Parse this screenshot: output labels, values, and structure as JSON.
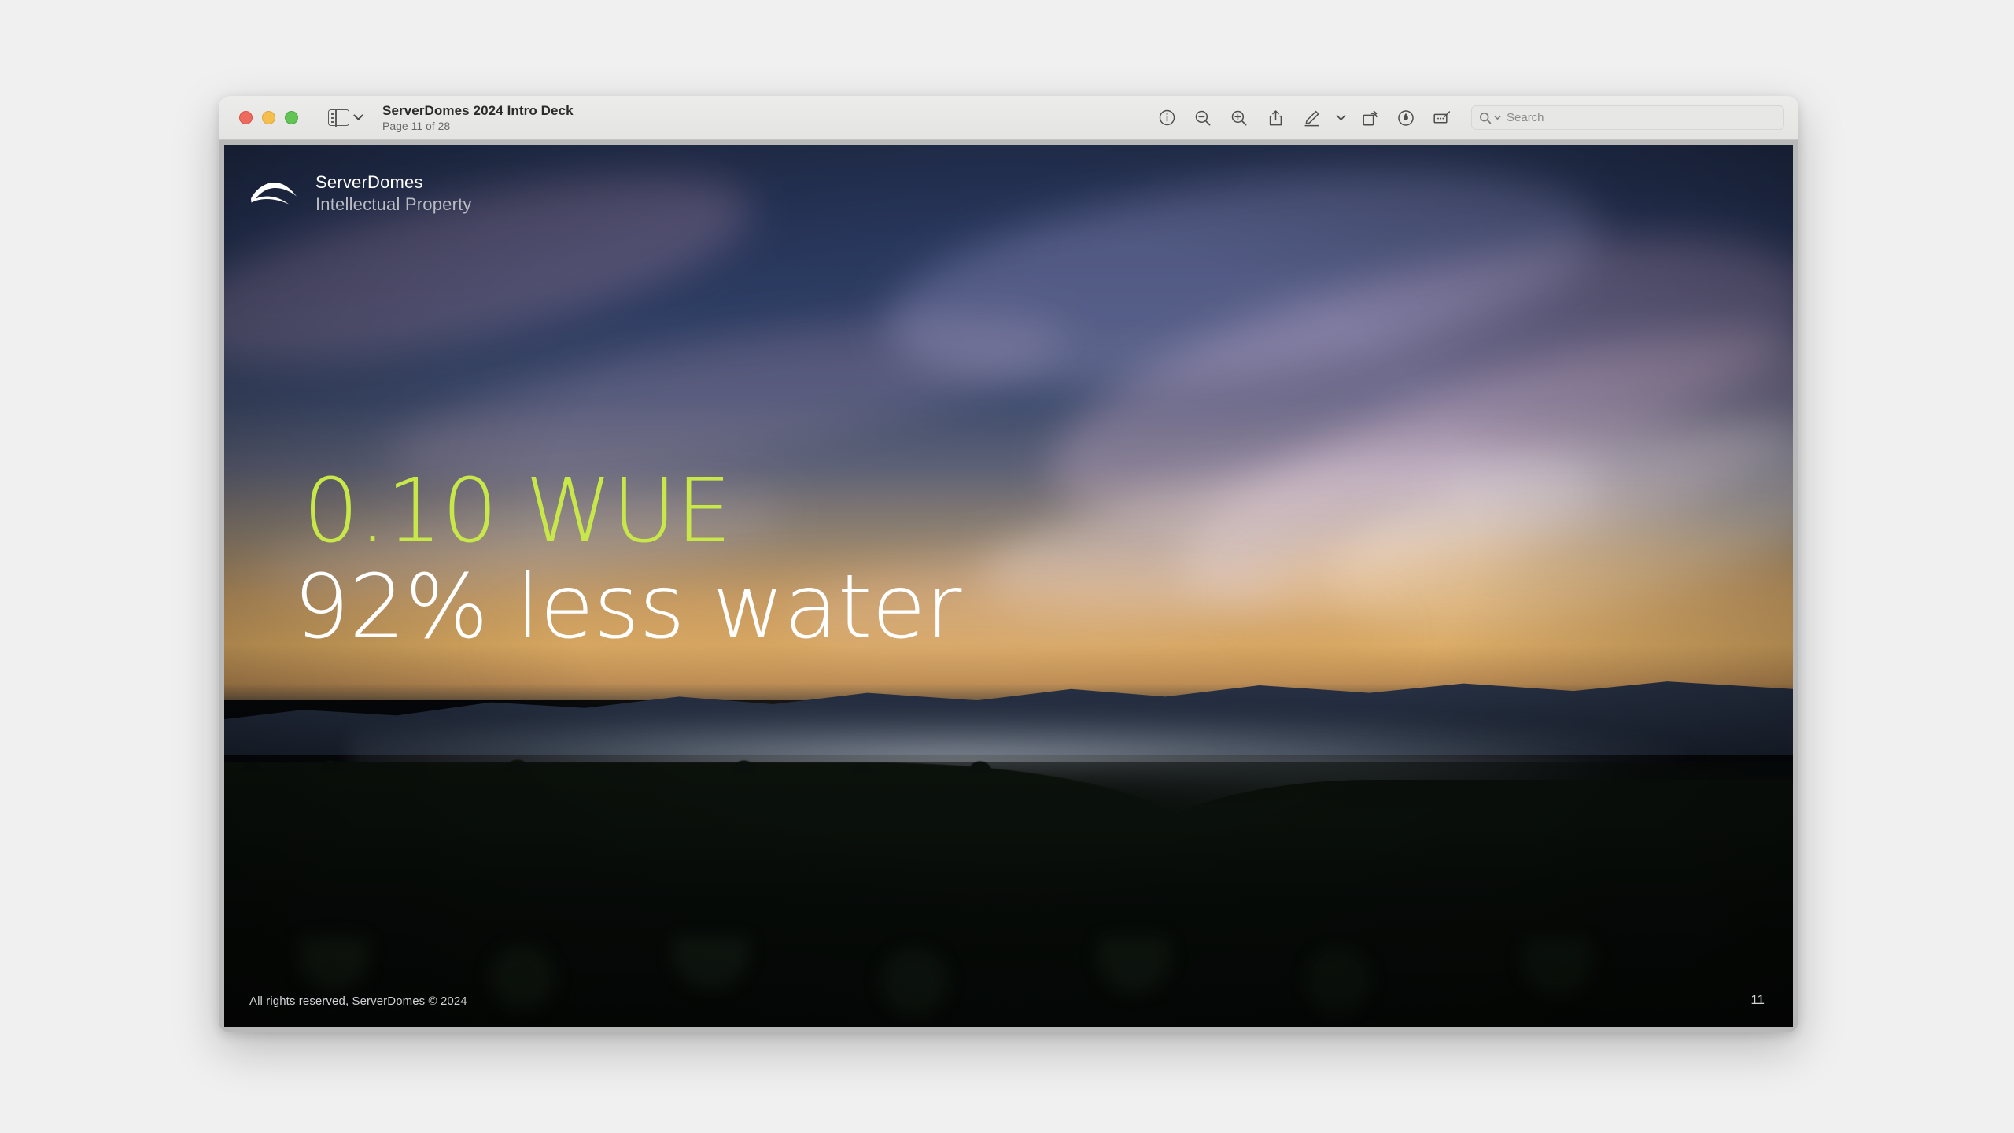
{
  "window": {
    "traffic_lights": [
      "close",
      "minimize",
      "zoom"
    ],
    "sidebar_toggle_icon": "sidebar-icon",
    "sidebar_chevron_icon": "chevron-down-icon",
    "document_title": "ServerDomes 2024 Intro Deck",
    "page_indicator": "Page 11 of 28"
  },
  "toolbar": {
    "buttons": [
      {
        "name": "info-icon",
        "label": "Info"
      },
      {
        "name": "zoom-out-icon",
        "label": "Zoom Out"
      },
      {
        "name": "zoom-in-icon",
        "label": "Zoom In"
      },
      {
        "name": "share-icon",
        "label": "Share"
      },
      {
        "name": "markup-pen-icon",
        "label": "Markup"
      },
      {
        "name": "markup-chevron-icon",
        "label": "Markup Options"
      },
      {
        "name": "rotate-right-icon",
        "label": "Rotate Right"
      },
      {
        "name": "highlight-icon",
        "label": "Highlight"
      },
      {
        "name": "annotate-icon",
        "label": "Annotate"
      }
    ],
    "search": {
      "placeholder": "Search",
      "value": "",
      "icon": "search-icon",
      "chevron": "chevron-down-icon"
    }
  },
  "slide": {
    "brand": {
      "logo_icon": "serverdomes-wing-logo",
      "name": "ServerDomes",
      "subtitle": "Intellectual Property"
    },
    "headline": {
      "line1": "0.10 WUE",
      "line2": "92% less water"
    },
    "footer": "All rights reserved, ServerDomes © 2024",
    "page_number": "11"
  },
  "colors": {
    "accent_green": "#c8e84a",
    "headline_white": "#ffffff",
    "titlebar_bg": "#ececea",
    "canvas_bg": "#b8b8b8",
    "desktop_bg": "#f0f0f0"
  }
}
